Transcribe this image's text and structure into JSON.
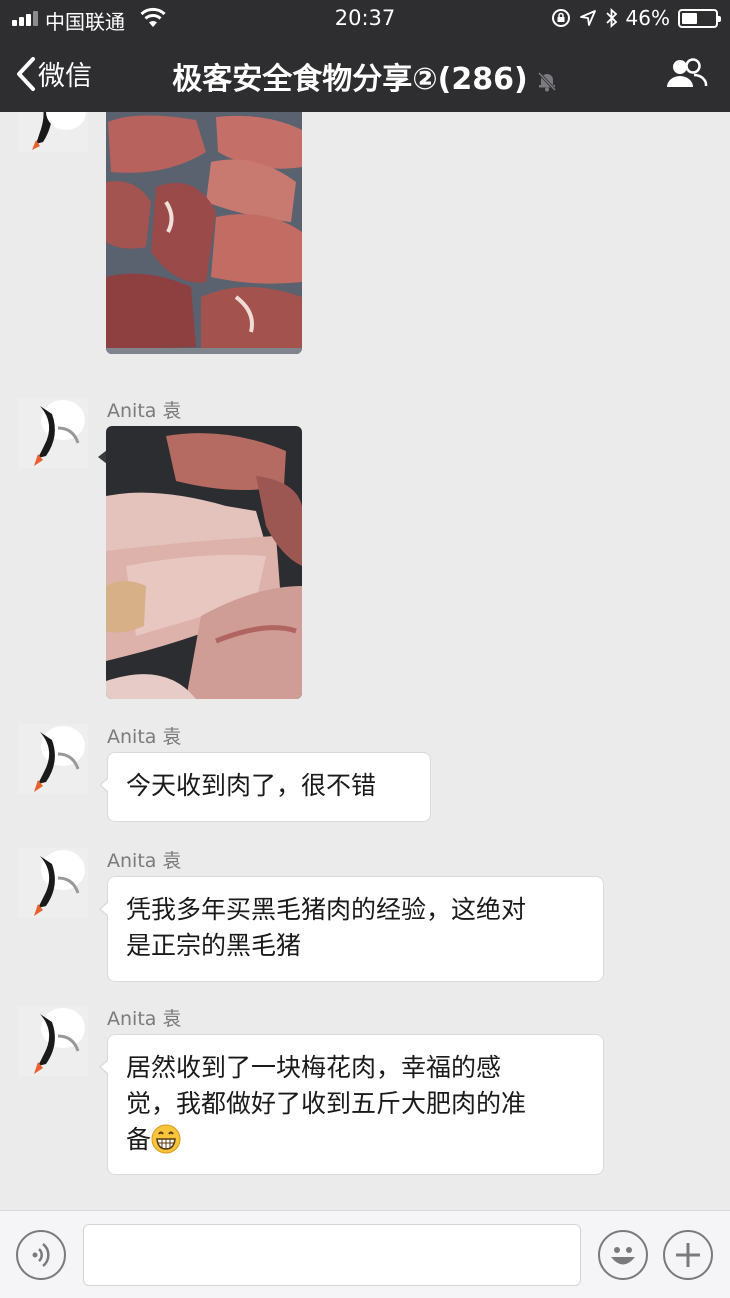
{
  "status_bar": {
    "carrier": "中国联通",
    "time": "20:37",
    "battery": "46%",
    "battery_level": 0.46
  },
  "nav": {
    "back_label": "微信",
    "title": "极客安全食物分享②(286)"
  },
  "messages": [
    {
      "type": "image",
      "subject": "raw pork chunks on tray"
    },
    {
      "type": "image",
      "sender": "Anita 袁",
      "subject": "hand holding pork piece"
    },
    {
      "type": "text",
      "sender": "Anita 袁",
      "text": "今天收到肉了，很不错"
    },
    {
      "type": "text",
      "sender": "Anita 袁",
      "lines": [
        "凭我多年买黑毛猪肉的经验，这绝对",
        "是正宗的黑毛猪"
      ]
    },
    {
      "type": "text",
      "sender": "Anita 袁",
      "lines": [
        "居然收到了一块梅花肉，幸福的感",
        "觉，我都做好了收到五斤大肥肉的准",
        "备"
      ],
      "emoji": "grinning-face"
    }
  ],
  "input_bar": {
    "placeholder": ""
  },
  "colors": {
    "header_bg": "#2e2e31",
    "chat_bg": "#ebebeb",
    "bubble_bg": "#ffffff"
  }
}
